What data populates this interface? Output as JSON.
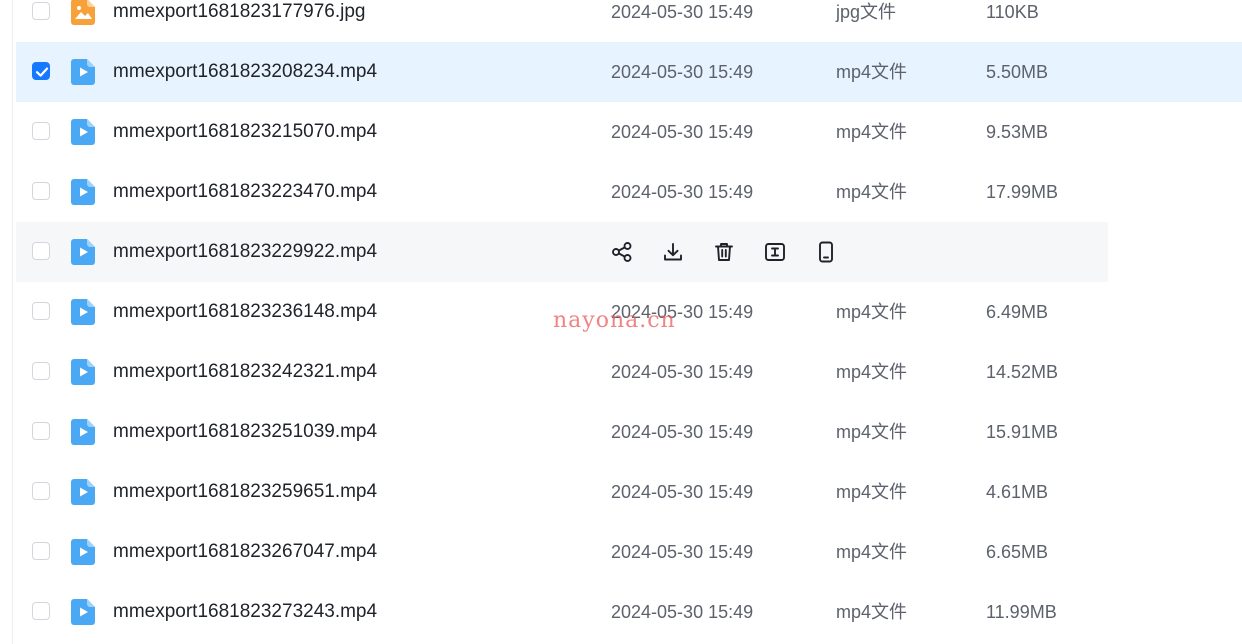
{
  "rows": [
    {
      "name": "mmexport1681823177976.jpg",
      "date": "2024-05-30 15:49",
      "type": "jpg文件",
      "size": "110KB",
      "icon": "image-file-icon",
      "checked": false,
      "state": "normal"
    },
    {
      "name": "mmexport1681823208234.mp4",
      "date": "2024-05-30 15:49",
      "type": "mp4文件",
      "size": "5.50MB",
      "icon": "video-file-icon",
      "checked": true,
      "state": "selected"
    },
    {
      "name": "mmexport1681823215070.mp4",
      "date": "2024-05-30 15:49",
      "type": "mp4文件",
      "size": "9.53MB",
      "icon": "video-file-icon",
      "checked": false,
      "state": "normal"
    },
    {
      "name": "mmexport1681823223470.mp4",
      "date": "2024-05-30 15:49",
      "type": "mp4文件",
      "size": "17.99MB",
      "icon": "video-file-icon",
      "checked": false,
      "state": "normal"
    },
    {
      "name": "mmexport1681823229922.mp4",
      "date": "",
      "type": "",
      "size": "",
      "icon": "video-file-icon",
      "checked": false,
      "state": "hovered"
    },
    {
      "name": "mmexport1681823236148.mp4",
      "date": "2024-05-30 15:49",
      "type": "mp4文件",
      "size": "6.49MB",
      "icon": "video-file-icon",
      "checked": false,
      "state": "normal"
    },
    {
      "name": "mmexport1681823242321.mp4",
      "date": "2024-05-30 15:49",
      "type": "mp4文件",
      "size": "14.52MB",
      "icon": "video-file-icon",
      "checked": false,
      "state": "normal"
    },
    {
      "name": "mmexport1681823251039.mp4",
      "date": "2024-05-30 15:49",
      "type": "mp4文件",
      "size": "15.91MB",
      "icon": "video-file-icon",
      "checked": false,
      "state": "normal"
    },
    {
      "name": "mmexport1681823259651.mp4",
      "date": "2024-05-30 15:49",
      "type": "mp4文件",
      "size": "4.61MB",
      "icon": "video-file-icon",
      "checked": false,
      "state": "normal"
    },
    {
      "name": "mmexport1681823267047.mp4",
      "date": "2024-05-30 15:49",
      "type": "mp4文件",
      "size": "6.65MB",
      "icon": "video-file-icon",
      "checked": false,
      "state": "normal"
    },
    {
      "name": "mmexport1681823273243.mp4",
      "date": "2024-05-30 15:49",
      "type": "mp4文件",
      "size": "11.99MB",
      "icon": "video-file-icon",
      "checked": false,
      "state": "normal"
    }
  ],
  "hover_actions": [
    "share-icon",
    "download-icon",
    "delete-icon",
    "rename-icon",
    "send-to-phone-icon"
  ],
  "watermark": "nayona.cn",
  "colors": {
    "accent": "#1677ff",
    "selected_row": "#e7f3fe",
    "hover_row": "#f6f7f9",
    "video_icon": "#4aa8f5",
    "image_icon": "#f7a13a",
    "text_primary": "#1f2329",
    "text_secondary": "#5c616b"
  }
}
